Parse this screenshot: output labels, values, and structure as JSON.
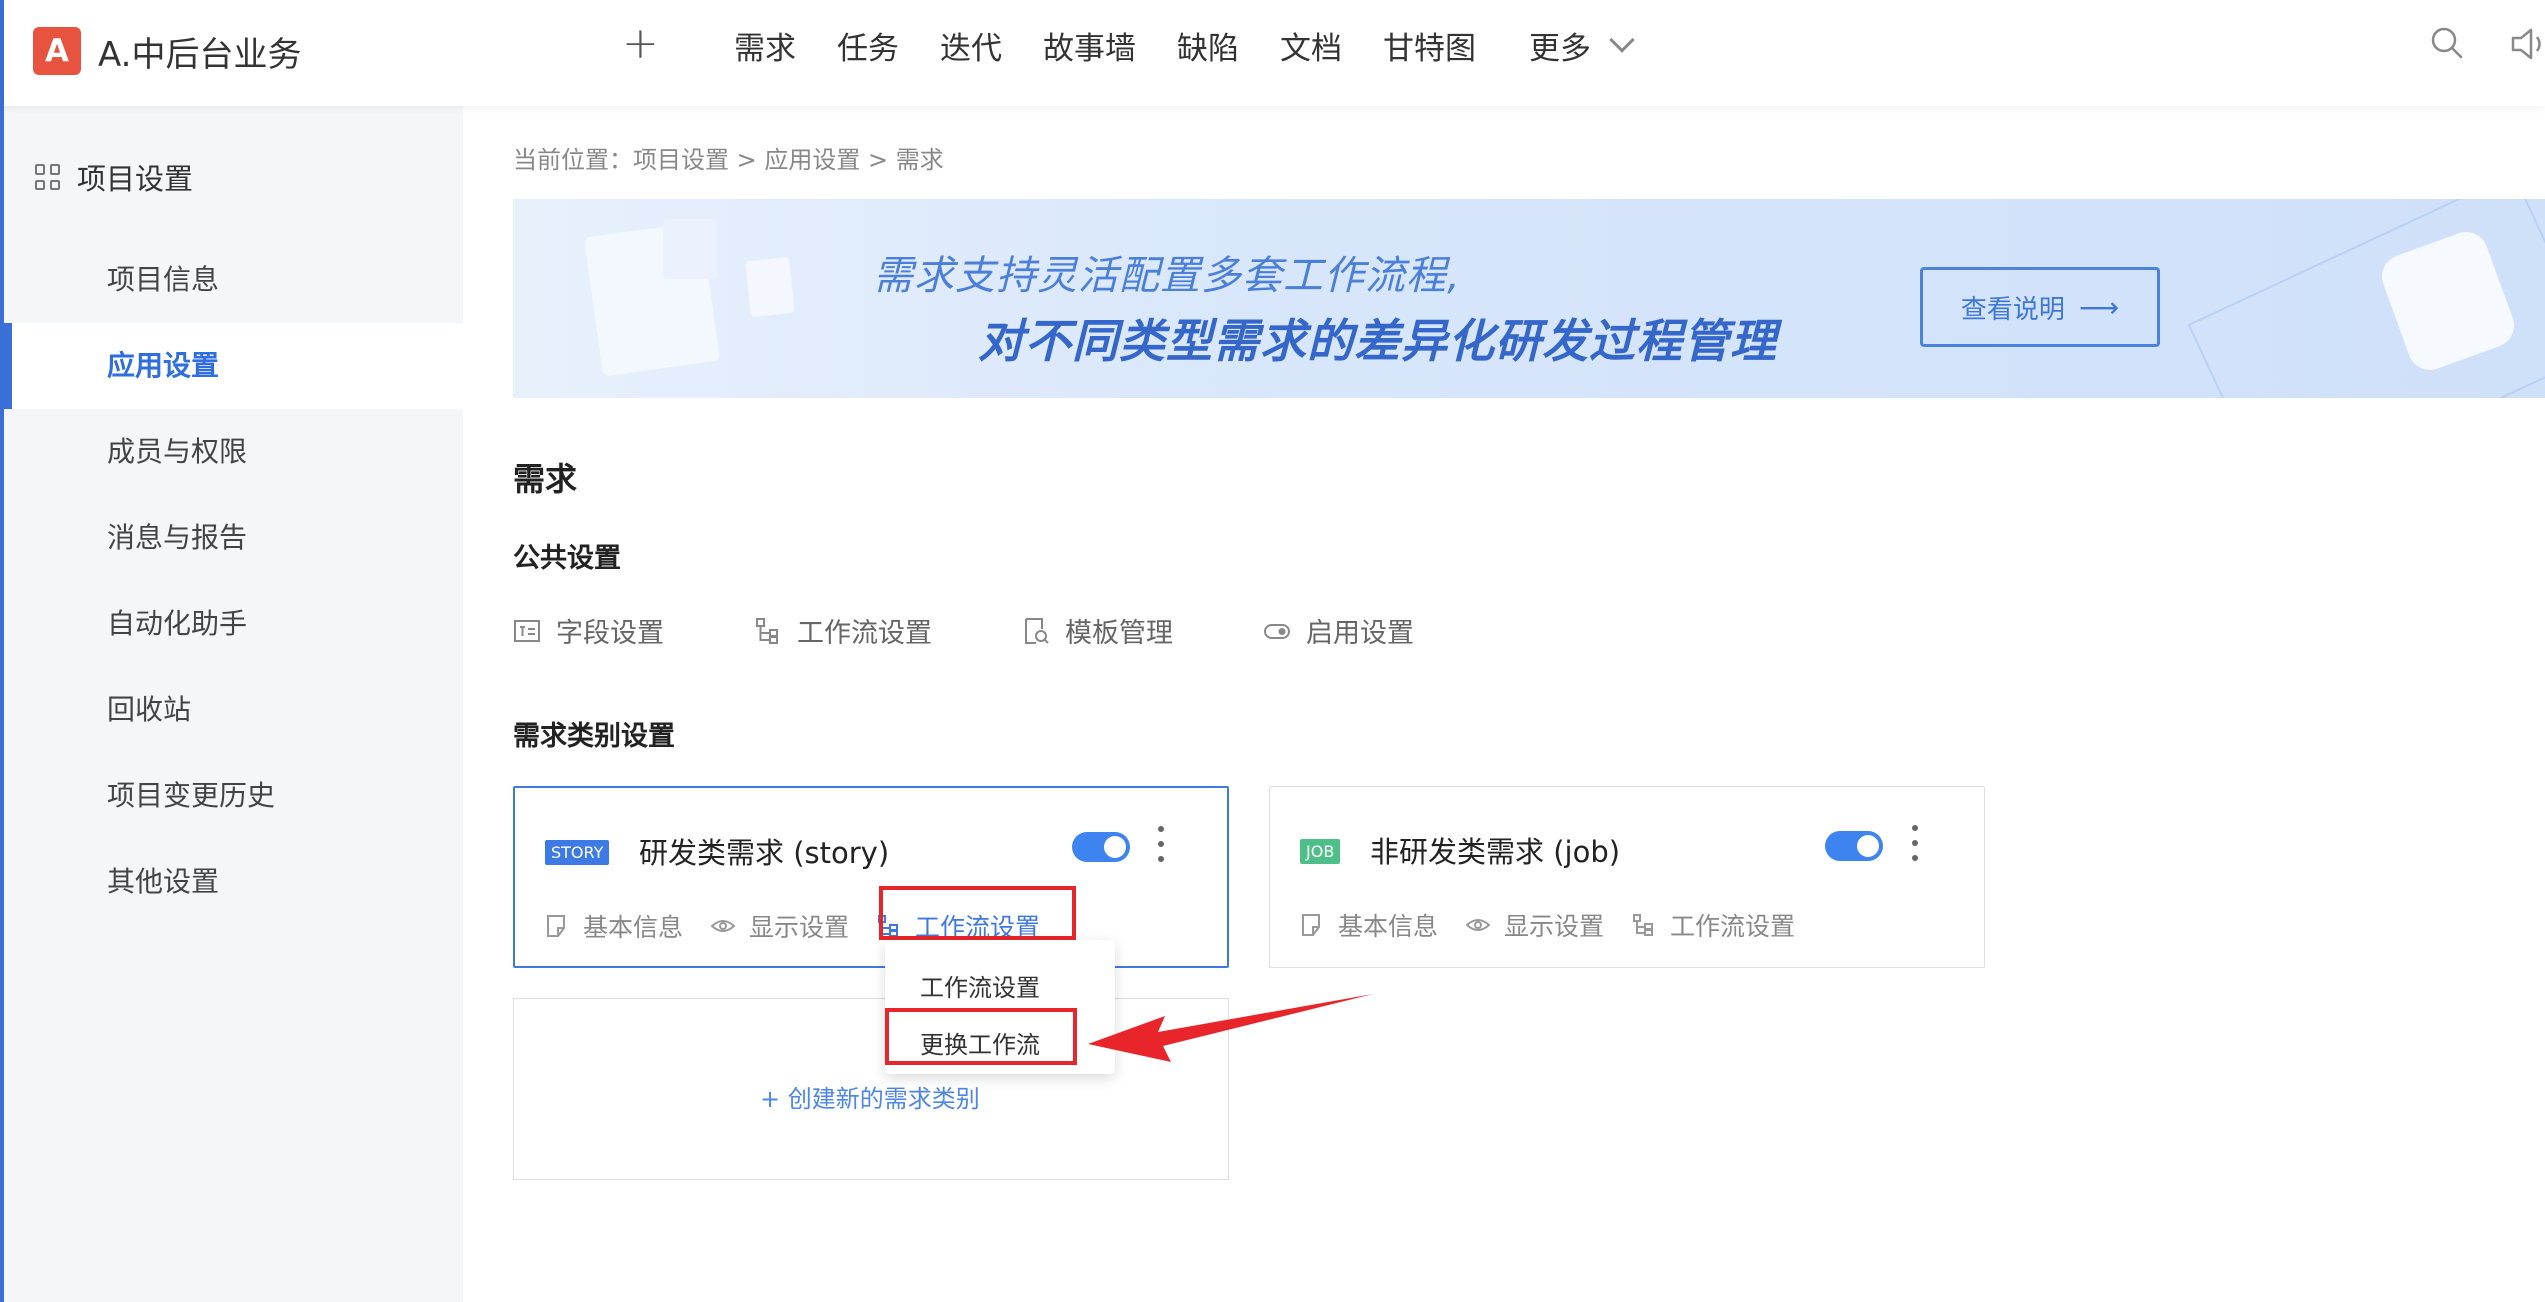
{
  "app": {
    "logo_letter": "A",
    "project_name": "A.中后台业务"
  },
  "topnav": {
    "plus": "+",
    "items": [
      "需求",
      "任务",
      "迭代",
      "故事墙",
      "缺陷",
      "文档",
      "甘特图"
    ],
    "more": "更多"
  },
  "sidebar": {
    "header": "项目设置",
    "items": [
      "项目信息",
      "应用设置",
      "成员与权限",
      "消息与报告",
      "自动化助手",
      "回收站",
      "项目变更历史",
      "其他设置"
    ],
    "active": "应用设置"
  },
  "breadcrumb": "当前位置：项目设置 > 应用设置 > 需求",
  "banner": {
    "line1": "需求支持灵活配置多套工作流程,",
    "line2": "对不同类型需求的差异化研发过程管理",
    "button": "查看说明",
    "button_arrow": "⟶"
  },
  "section": {
    "title": "需求",
    "public_title": "公共设置",
    "public_items": [
      "字段设置",
      "工作流设置",
      "模板管理",
      "启用设置"
    ],
    "category_title": "需求类别设置"
  },
  "cards": [
    {
      "tag": "STORY",
      "title": "研发类需求 (story)",
      "enabled": true,
      "links": [
        "基本信息",
        "显示设置",
        "工作流设置"
      ]
    },
    {
      "tag": "JOB",
      "title": "非研发类需求 (job)",
      "enabled": true,
      "links": [
        "基本信息",
        "显示设置",
        "工作流设置"
      ]
    }
  ],
  "dropdown": {
    "items": [
      "工作流设置",
      "更换工作流"
    ]
  },
  "new_category": "+ 创建新的需求类别",
  "colors": {
    "accent": "#3e78e0",
    "logo": "#e8533f",
    "story_tag": "#3d7ae5",
    "job_tag": "#4fbf8a",
    "annotation": "#e8252b"
  }
}
